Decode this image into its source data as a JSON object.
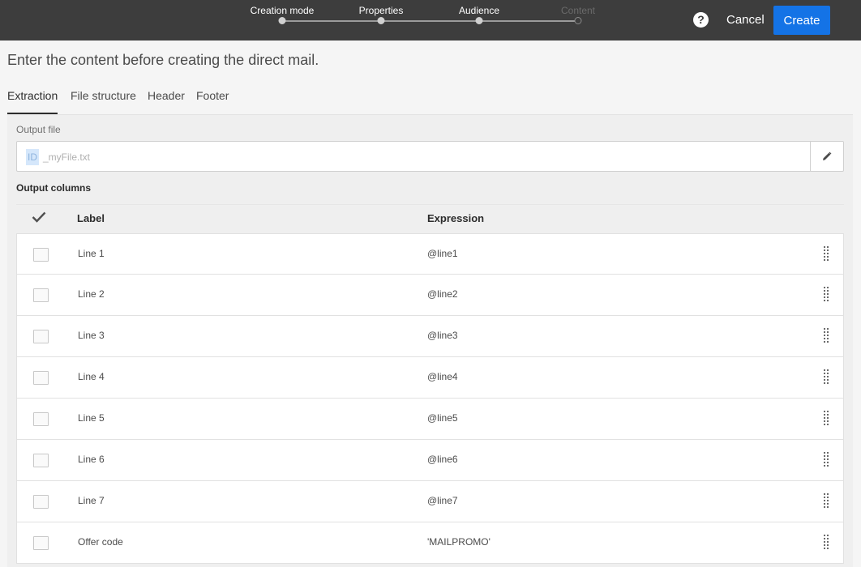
{
  "wizard": {
    "steps": [
      {
        "label": "Creation mode",
        "state": "done"
      },
      {
        "label": "Properties",
        "state": "done"
      },
      {
        "label": "Audience",
        "state": "done"
      },
      {
        "label": "Content",
        "state": "current"
      }
    ],
    "help_label": "?",
    "cancel_label": "Cancel",
    "create_label": "Create"
  },
  "page": {
    "title": "Enter the content before creating the direct mail."
  },
  "tabs": [
    {
      "label": "Extraction",
      "active": true
    },
    {
      "label": "File structure",
      "active": false
    },
    {
      "label": "Header",
      "active": false
    },
    {
      "label": "Footer",
      "active": false
    }
  ],
  "output_file": {
    "label": "Output file",
    "id_token": "ID",
    "value": "_myFile.txt",
    "edit_icon": "pencil-icon"
  },
  "output_columns": {
    "heading": "Output columns",
    "headers": {
      "check_icon": "checkmark-icon",
      "label": "Label",
      "expression": "Expression"
    },
    "rows": [
      {
        "label": "Line 1",
        "expression": "@line1"
      },
      {
        "label": "Line 2",
        "expression": "@line2"
      },
      {
        "label": "Line 3",
        "expression": "@line3"
      },
      {
        "label": "Line 4",
        "expression": "@line4"
      },
      {
        "label": "Line 5",
        "expression": "@line5"
      },
      {
        "label": "Line 6",
        "expression": "@line6"
      },
      {
        "label": "Line 7",
        "expression": "@line7"
      },
      {
        "label": "Offer code",
        "expression": "'MAILPROMO'"
      }
    ]
  },
  "colors": {
    "topbar": "#3d3d3d",
    "accent": "#1473e6",
    "id_token_bg": "#d5e7fb"
  }
}
